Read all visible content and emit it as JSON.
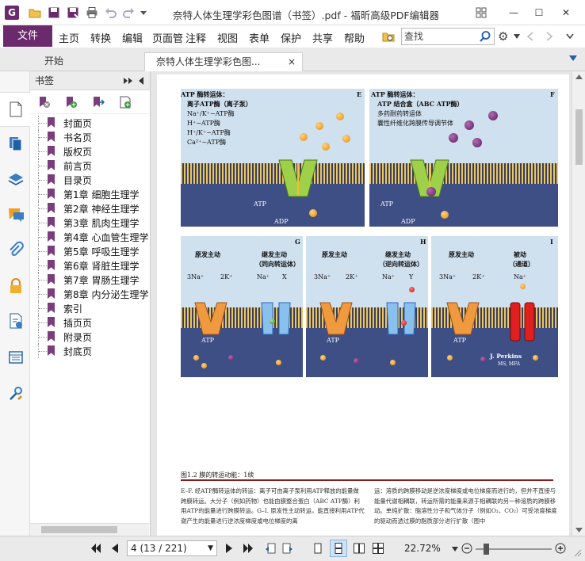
{
  "titlebar": {
    "title": "奈特人体生理学彩色图谱（书签）.pdf - 福昕高级PDF编辑器",
    "logo": "G",
    "minimize_label": "—",
    "restore_label": "☐",
    "close_label": "✕",
    "settings_label": "⚙"
  },
  "menu": {
    "file_label": "文件",
    "items": [
      "主页",
      "转换",
      "编辑",
      "页面管",
      "注释",
      "视图",
      "表单",
      "保护",
      "共享",
      "帮助"
    ],
    "search_placeholder": "查找"
  },
  "tabs": {
    "home_label": "开始",
    "doc_label": "奈特人体生理学彩色图...",
    "close_label": "×"
  },
  "bookmarks": {
    "header": "书签",
    "items": [
      "封面页",
      "书名页",
      "版权页",
      "前言页",
      "目录页",
      "第1章 细胞生理学",
      "第2章 神经生理学",
      "第3章 肌肉生理学",
      "第4章 心血管生理学",
      "第5章 呼吸生理学",
      "第6章 肾脏生理学",
      "第7章 胃肠生理学",
      "第8章 内分泌生理学",
      "索引",
      "插页页",
      "附录页",
      "封底页"
    ]
  },
  "figure": {
    "panel_e": {
      "letter": "E",
      "lines": [
        "ATP 酶转运体：",
        "离子ATP酶（离子泵）",
        "Na⁺/K⁺−ATP酶",
        "H⁺−ATP酶",
        "H⁺/K⁺−ATP酶",
        "Ca²⁺−ATP酶"
      ],
      "atp": "ATP",
      "adp": "ADP"
    },
    "panel_f": {
      "letter": "F",
      "lines": [
        "ATP 酶转运体：",
        "ATP 结合盒（ABC ATP酶）",
        "多药耐药转运体",
        "囊性纤维化跨膜传导调节体"
      ],
      "atp": "ATP",
      "adp": "ADP"
    },
    "panel_g": {
      "letter": "G",
      "left_title": "原发主动",
      "right_title_1": "继发主动",
      "right_title_2": "（同向转运体）",
      "ions": [
        "3Na⁺",
        "2K⁺",
        "Na⁺",
        "X"
      ],
      "atp": "ATP"
    },
    "panel_h": {
      "letter": "H",
      "left_title": "原发主动",
      "right_title_1": "继发主动",
      "right_title_2": "（逆向转运体）",
      "ions": [
        "3Na⁺",
        "2K⁺",
        "Na⁺",
        "Y"
      ],
      "atp": "ATP"
    },
    "panel_i": {
      "letter": "I",
      "left_title": "原发主动",
      "right_title_1": "被动",
      "right_title_2": "（通道）",
      "ions": [
        "3Na⁺",
        "2K⁺",
        "Na⁺"
      ],
      "atp": "ATP",
      "sig_name": "J. Perkins",
      "sig_sub": "MS, MFA"
    },
    "caption": "图1.2   膜的转运动能：1续",
    "body_left": "E–F. 经ATP酶转运体的转运：离子可由离子泵利用ATP释放的能量做跨膜转运。大分子（例如药物）也能由膜整合蛋白（ABC ATP酶）利用ATP的能量进行跨膜转运。G–I. 原发性主动转运，能直接利用ATP代谢产生的能量进行逆浓度梯度或电位梯度的离",
    "body_right": "运：溶质的跨膜移动是逆浓度梯度或电位梯度而进行的，但并不直接与能量代谢相耦联，转运所需的能量来源于相耦联的另一种溶质的跨膜移动。单纯扩散：脂溶性分子和气体分子（例如O₂、CO₂）可受浓度梯度的驱动而透过膜的脂质部分进行扩散（图中"
  },
  "status": {
    "page_value": "4 (13 / 221)",
    "zoom": "22.72%",
    "zoom_level_percent": 22.72
  },
  "colors": {
    "brand": "#6a2a6d",
    "bookmark_flag": "#7b3e7d",
    "figure_rule": "#8b1a1a"
  }
}
